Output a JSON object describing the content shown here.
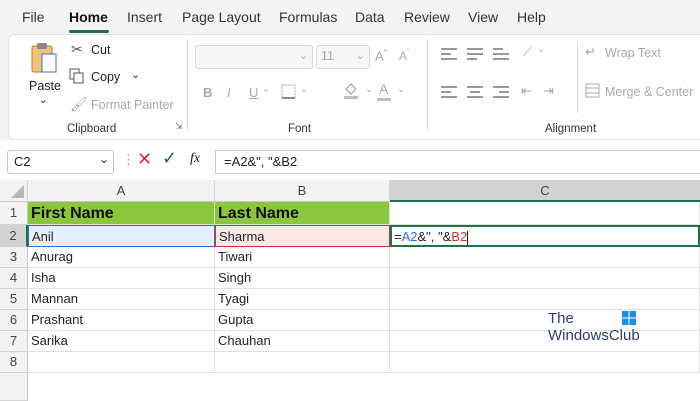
{
  "menu": {
    "file": "File",
    "home": "Home",
    "insert": "Insert",
    "page_layout": "Page Layout",
    "formulas": "Formulas",
    "data": "Data",
    "review": "Review",
    "view": "View",
    "help": "Help"
  },
  "ribbon": {
    "paste": "Paste",
    "cut": "Cut",
    "copy": "Copy",
    "format_painter": "Format Painter",
    "clipboard_label": "Clipboard",
    "font_size": "11",
    "font_label": "Font",
    "wrap_text": "Wrap Text",
    "merge_center": "Merge & Center",
    "alignment_label": "Alignment",
    "bold": "B",
    "italic": "I",
    "underline": "U"
  },
  "formula_bar": {
    "name_box": "C2",
    "fx": "fx",
    "formula_part1": "=A2&\", \"&B2"
  },
  "columns": [
    "A",
    "B",
    "C"
  ],
  "rows": [
    "1",
    "2",
    "3",
    "4",
    "5",
    "6",
    "7",
    "8"
  ],
  "table": {
    "headers": [
      "First Name",
      "Last Name"
    ],
    "data": [
      [
        "Anil",
        "Sharma"
      ],
      [
        "Anurag",
        "Tiwari"
      ],
      [
        "Isha",
        "Singh"
      ],
      [
        "Mannan",
        "Tyagi"
      ],
      [
        "Prashant",
        "Gupta"
      ],
      [
        "Sarika",
        "Chauhan"
      ]
    ]
  },
  "edit_cell": {
    "prefix": "=",
    "ref1": "A2",
    "middle": "&\", \"&",
    "ref2": "B2"
  },
  "watermark": {
    "line1": "The",
    "line2": "WindowsClub"
  },
  "colors": {
    "accent": "#1e7145",
    "header_fill": "#8cc63f",
    "ref_blue": "#2e6fd8",
    "ref_red": "#c0392b"
  }
}
